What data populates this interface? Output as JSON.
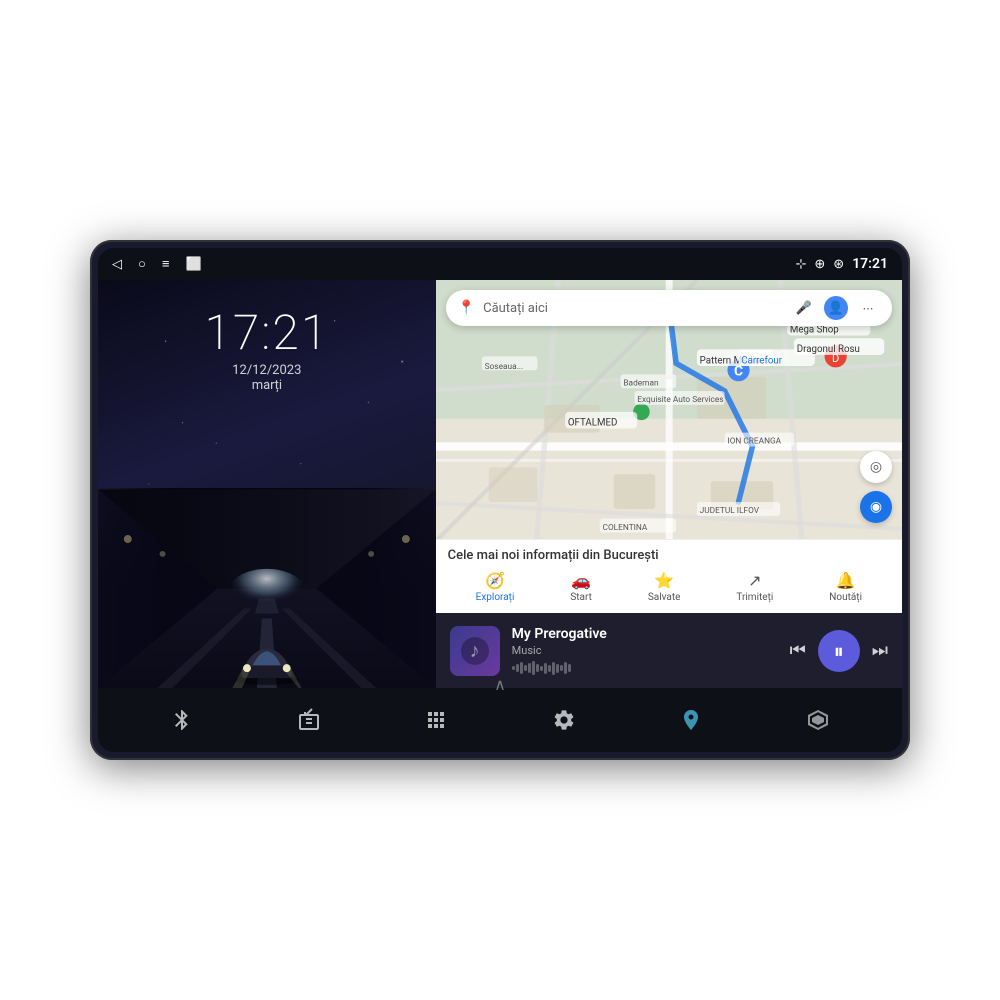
{
  "device": {
    "status_bar": {
      "time": "17:21",
      "icons": {
        "bluetooth": "⬩",
        "location": "◉",
        "wifi": "◈",
        "battery": "▮"
      },
      "nav_icons": {
        "back": "◁",
        "home": "○",
        "menu": "≡",
        "recent": "⬜"
      }
    },
    "left_panel": {
      "clock_time": "17:21",
      "clock_date": "12/12/2023",
      "clock_day": "marți"
    },
    "right_panel": {
      "map": {
        "search_placeholder": "Căutați aici",
        "info_title": "Cele mai noi informații din București",
        "nav_tabs": [
          {
            "label": "Explorați",
            "icon": "🧭",
            "active": true
          },
          {
            "label": "Start",
            "icon": "🚗"
          },
          {
            "label": "Salvate",
            "icon": "⭐"
          },
          {
            "label": "Trimiteți",
            "icon": "↗"
          },
          {
            "label": "Noutăți",
            "icon": "🔔"
          }
        ]
      },
      "music": {
        "title": "My Prerogative",
        "artist": "Music",
        "waveform_bars": [
          4,
          8,
          12,
          6,
          10,
          14,
          8,
          5,
          11,
          7,
          13,
          9,
          6,
          12,
          8
        ]
      }
    },
    "bottom_nav": {
      "items": [
        {
          "icon": "bluetooth",
          "label": "Bluetooth"
        },
        {
          "icon": "radio",
          "label": "Radio"
        },
        {
          "icon": "apps",
          "label": "Apps"
        },
        {
          "icon": "settings",
          "label": "Settings"
        },
        {
          "icon": "maps",
          "label": "Maps"
        },
        {
          "icon": "3d",
          "label": "3D"
        }
      ]
    }
  }
}
